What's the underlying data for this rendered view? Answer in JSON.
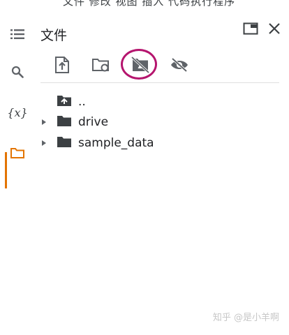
{
  "top_menu": {
    "text": "文件  修改  视图  插入  代码执行程序"
  },
  "rail": {
    "items": [
      {
        "name": "table-of-contents",
        "icon": "list-icon"
      },
      {
        "name": "search",
        "icon": "search-icon"
      },
      {
        "name": "variables",
        "icon": "variables-icon",
        "label": "{x}"
      },
      {
        "name": "files",
        "icon": "folder-icon",
        "active": true
      }
    ],
    "active_color": "#e37400"
  },
  "panel": {
    "title": "文件",
    "toolbar": [
      {
        "name": "upload",
        "icon": "upload-file-icon"
      },
      {
        "name": "refresh",
        "icon": "folder-refresh-icon"
      },
      {
        "name": "mount-drive",
        "icon": "drive-off-icon",
        "highlighted": true
      },
      {
        "name": "toggle-hidden",
        "icon": "eye-off-icon"
      }
    ],
    "highlight_color": "#b5156e",
    "tree": [
      {
        "label": "..",
        "icon": "folder-up-icon",
        "expandable": false
      },
      {
        "label": "drive",
        "icon": "folder-icon",
        "expandable": true
      },
      {
        "label": "sample_data",
        "icon": "folder-icon",
        "expandable": true
      }
    ]
  },
  "watermark": {
    "text": "知乎 @是小羊啊"
  }
}
